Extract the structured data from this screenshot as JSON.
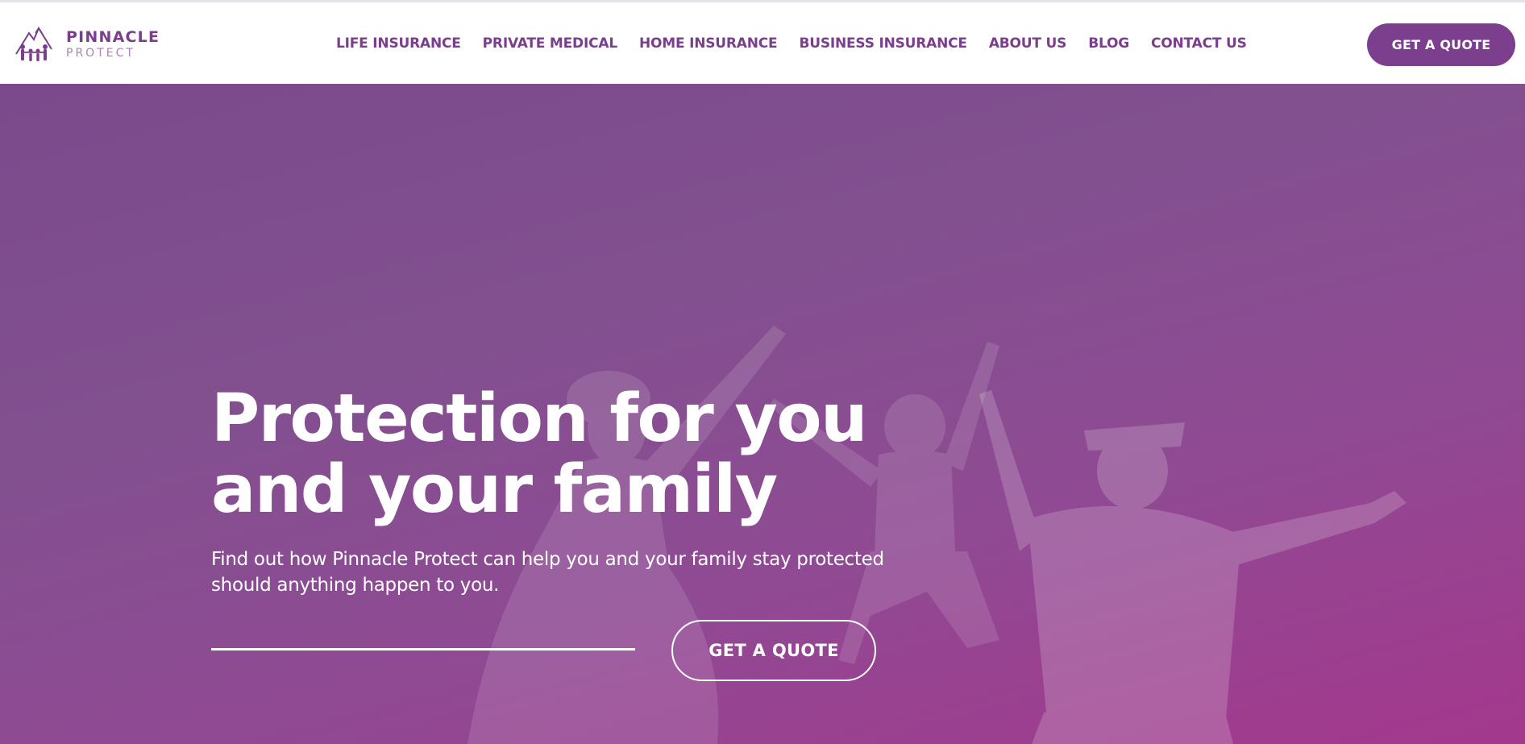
{
  "brand": {
    "name_line1": "PINNACLE",
    "name_line2": "PROTECT",
    "logo_icon": "mountain-family-icon",
    "color_primary": "#7a3e8c",
    "color_secondary": "#a983b3"
  },
  "nav": {
    "items": [
      {
        "label": "LIFE INSURANCE"
      },
      {
        "label": "PRIVATE MEDICAL"
      },
      {
        "label": "HOME INSURANCE"
      },
      {
        "label": "BUSINESS INSURANCE"
      },
      {
        "label": "ABOUT US"
      },
      {
        "label": "BLOG"
      },
      {
        "label": "CONTACT US"
      }
    ],
    "cta_label": "GET A QUOTE",
    "cta_color": "#7c3f8e"
  },
  "hero": {
    "title_line1": "Protection for you",
    "title_line2": "and your family",
    "subtitle": "Find out how Pinnacle Protect can help you and your family stay protected should anything happen to you.",
    "cta_label": "GET A QUOTE",
    "overlay_colors": [
      "#7a4a8c",
      "#a4388d"
    ]
  }
}
